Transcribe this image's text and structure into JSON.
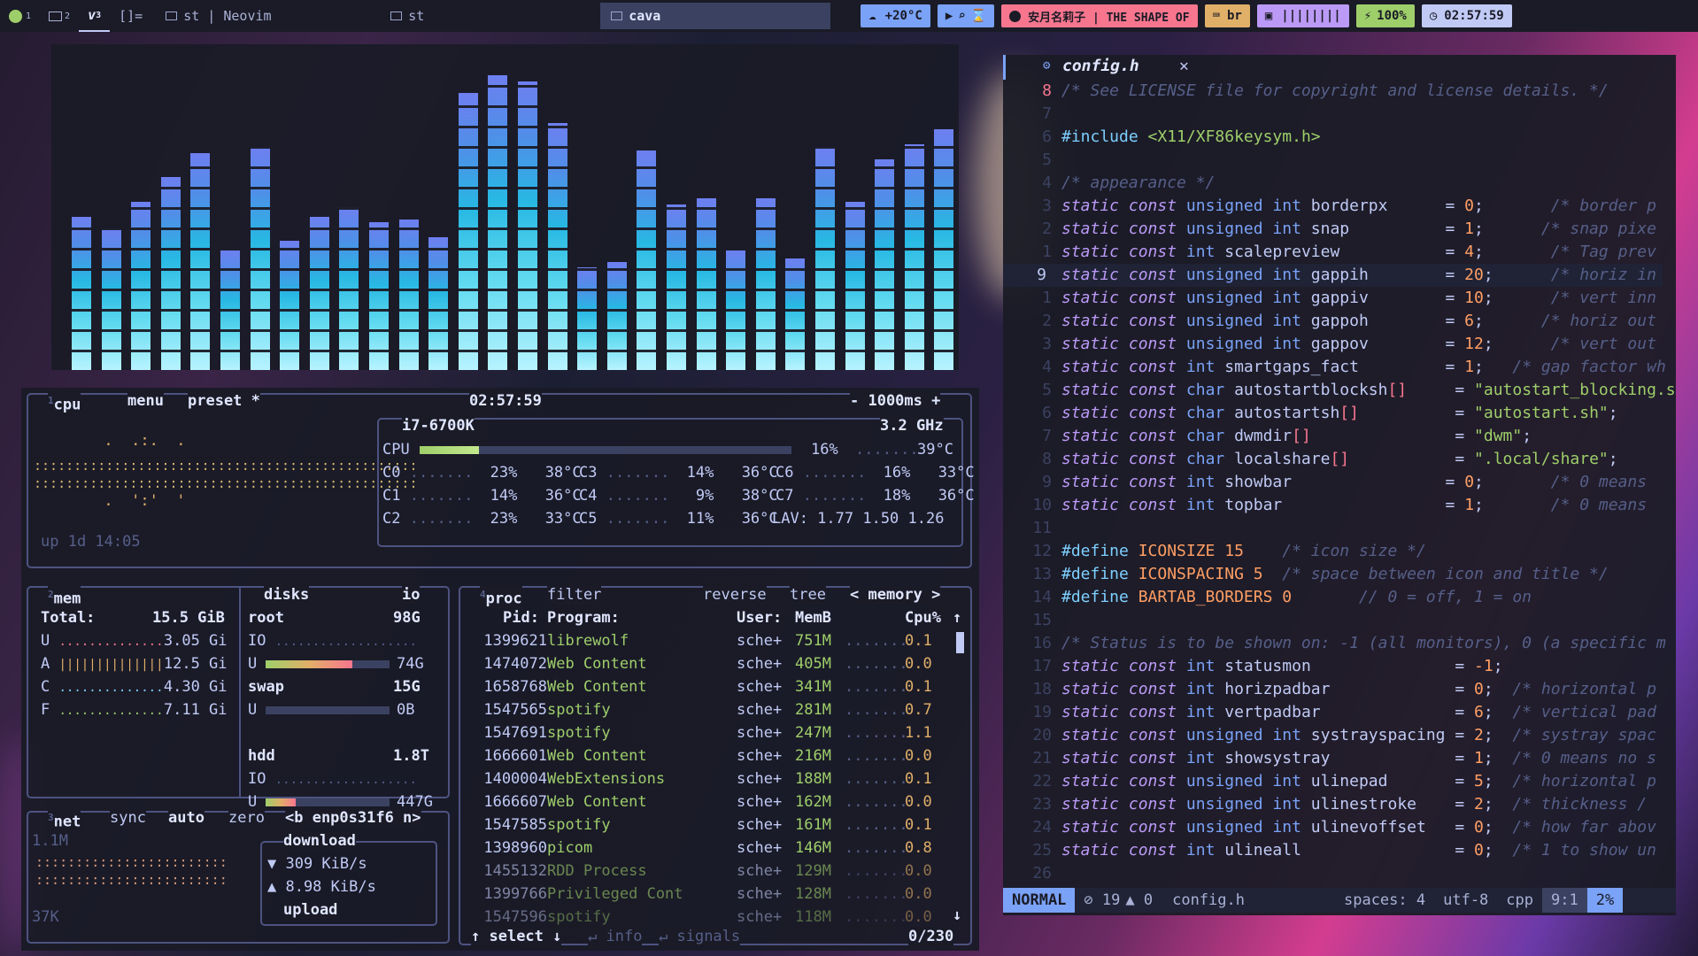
{
  "topbar": {
    "tags": [
      "1",
      "2",
      "3",
      "[]="
    ],
    "windows": [
      "st | Neovim",
      "st",
      "cava"
    ],
    "weather": "+20°C",
    "song": "安月名莉子 | THE SHAPE OF",
    "keyboard": "br",
    "cpu_bars": "||||||||",
    "battery": "100%",
    "clock": "02:57:59"
  },
  "cava": {
    "bars": [
      0.51,
      0.47,
      0.56,
      0.64,
      0.72,
      0.4,
      0.74,
      0.43,
      0.51,
      0.54,
      0.49,
      0.5,
      0.44,
      0.92,
      0.98,
      0.96,
      0.82,
      0.34,
      0.36,
      0.73,
      0.55,
      0.57,
      0.4,
      0.57,
      0.37,
      0.74,
      0.56,
      0.7,
      0.75,
      0.8
    ]
  },
  "btop": {
    "cpu": {
      "title": "cpu",
      "menu": "menu",
      "preset": "preset *",
      "clock": "02:57:59",
      "interval": "- 1000ms +",
      "model": "i7-6700K",
      "freq": "3.2 GHz",
      "total": {
        "label": "CPU",
        "pct": "16%",
        "temp": "39°C",
        "fill": 0.16
      },
      "cores": [
        {
          "name": "C0",
          "pct": "23%",
          "temp": "38°C"
        },
        {
          "name": "C1",
          "pct": "14%",
          "temp": "36°C"
        },
        {
          "name": "C2",
          "pct": "23%",
          "temp": "33°C"
        },
        {
          "name": "C3",
          "pct": "14%",
          "temp": "36°C"
        },
        {
          "name": "C4",
          "pct": "9%",
          "temp": "38°C"
        },
        {
          "name": "C5",
          "pct": "11%",
          "temp": "36°C"
        },
        {
          "name": "C6",
          "pct": "16%",
          "temp": "33°C"
        },
        {
          "name": "C7",
          "pct": "18%",
          "temp": "36°C"
        }
      ],
      "lav": "LAV: 1.77 1.50 1.26",
      "uptime": "up 1d 14:05"
    },
    "mem": {
      "title": "mem",
      "total_label": "Total:",
      "total": "15.5 GiB",
      "rows": [
        {
          "l": "U",
          "v": "3.05 Gi"
        },
        {
          "l": "A",
          "v": "12.5 Gi"
        },
        {
          "l": "C",
          "v": "4.30 Gi"
        },
        {
          "l": "F",
          "v": "7.11 Gi"
        }
      ]
    },
    "disks": {
      "title": "disks",
      "io": "io",
      "items": [
        {
          "name": "root",
          "size": "98G",
          "used": "74G",
          "fill": 0.7
        },
        {
          "name": "swap",
          "size": "15G",
          "used": "0B",
          "fill": 0.0
        },
        {
          "name": "hdd",
          "size": "1.8T",
          "used": "447G",
          "fill": 0.24
        }
      ],
      "io_label": "IO",
      "u_label": "U"
    },
    "net": {
      "title": "net",
      "sync": "sync",
      "auto": "auto",
      "zero": "zero",
      "iface": "<b enp0s31f6 n>",
      "top": "1.1M",
      "bottom": "37K",
      "download_label": "download",
      "down": "▼ 309 KiB/s",
      "up": "▲ 8.98 KiB/s",
      "upload_label": "upload"
    },
    "proc": {
      "title": "proc",
      "filter": "filter",
      "reverse": "reverse",
      "tree": "tree",
      "sort": "< memory >",
      "headers": [
        "Pid:",
        "Program:",
        "User:",
        "MemB",
        "Cpu%"
      ],
      "rows": [
        [
          "1399621",
          "librewolf",
          "sche+",
          "751M",
          "0.1"
        ],
        [
          "1474072",
          "Web Content",
          "sche+",
          "405M",
          "0.0"
        ],
        [
          "1658768",
          "Web Content",
          "sche+",
          "341M",
          "0.1"
        ],
        [
          "1547565",
          "spotify",
          "sche+",
          "281M",
          "0.7"
        ],
        [
          "1547691",
          "spotify",
          "sche+",
          "247M",
          "1.1"
        ],
        [
          "1666601",
          "Web Content",
          "sche+",
          "216M",
          "0.0"
        ],
        [
          "1400004",
          "WebExtensions",
          "sche+",
          "188M",
          "0.1"
        ],
        [
          "1666607",
          "Web Content",
          "sche+",
          "162M",
          "0.0"
        ],
        [
          "1547585",
          "spotify",
          "sche+",
          "161M",
          "0.1"
        ],
        [
          "1398960",
          "picom",
          "sche+",
          "146M",
          "0.8"
        ],
        [
          "1455132",
          "RDD Process",
          "sche+",
          "129M",
          "0.0"
        ],
        [
          "1399766",
          "Privileged Cont",
          "sche+",
          "128M",
          "0.0"
        ],
        [
          "1547596",
          "spotify",
          "sche+",
          "118M",
          "0.0"
        ]
      ],
      "select": "select",
      "info": "info",
      "signals": "signals",
      "count": "0/230"
    }
  },
  "nvim": {
    "tab": "config.h",
    "cursor_line_num": "9",
    "lines": [
      [
        "8",
        "c:/* See LICENSE file for copyright and license details. */"
      ],
      [
        "7",
        ""
      ],
      [
        "6",
        "p:#include |s:<X11/XF86keysym.h>"
      ],
      [
        "5",
        ""
      ],
      [
        "4",
        "c:/* appearance */"
      ],
      [
        "3",
        "k:static const |t:unsigned int |x:borderpx      = |n:0|x:;       |c:/* border p"
      ],
      [
        "2",
        "k:static const |t:unsigned int |x:snap          = |n:1|x:;      |c:/* snap pixe"
      ],
      [
        "1",
        "k:static const |t:int |x:scalepreview           = |n:4|x:;       |c:/* Tag prev"
      ],
      [
        "9",
        "k:static const |t:unsigned int |x:gappih        = |n:20|x:;      |c:/* horiz in"
      ],
      [
        "1",
        "k:static const |t:unsigned int |x:gappiv        = |n:10|x:;      |c:/* vert inn"
      ],
      [
        "2",
        "k:static const |t:unsigned int |x:gappoh        = |n:6|x:;      |c:/* horiz out"
      ],
      [
        "3",
        "k:static const |t:unsigned int |x:gappov        = |n:12|x:;      |c:/* vert out"
      ],
      [
        "4",
        "k:static const |t:int |x:smartgaps_fact         = |n:1|x:;   |c:/* gap factor wh"
      ],
      [
        "5",
        "k:static const |t:char |x:autostartblocksh|r:[]|x:     = |s:\"autostart_blocking.s"
      ],
      [
        "6",
        "k:static const |t:char |x:autostartsh|r:[]|x:          = |s:\"autostart.sh\"|x:;"
      ],
      [
        "7",
        "k:static const |t:char |x:dwmdir|r:[]|x:               = |s:\"dwm\"|x:;"
      ],
      [
        "8",
        "k:static const |t:char |x:localshare|r:[]|x:           = |s:\".local/share\"|x:;"
      ],
      [
        "9",
        "k:static const |t:int |x:showbar                = |n:0|x:;       |c:/* 0 means"
      ],
      [
        "10",
        "k:static const |t:int |x:topbar                 = |n:1|x:;       |c:/* 0 means"
      ],
      [
        "11",
        ""
      ],
      [
        "12",
        "p:#define |n:ICONSIZE 15    |c:/* icon size */"
      ],
      [
        "13",
        "p:#define |n:ICONSPACING 5  |c:/* space between icon and title */"
      ],
      [
        "14",
        "p:#define |n:BARTAB_BORDERS 0       |c:// 0 = off, 1 = on"
      ],
      [
        "15",
        ""
      ],
      [
        "16",
        "c:/* Status is to be shown on: -1 (all monitors), 0 (a specific m"
      ],
      [
        "17",
        "k:static const |t:int |x:statusmon               = |n:-1|x:;"
      ],
      [
        "18",
        "k:static const |t:int |x:horizpadbar             = |n:0|x:;  |c:/* horizontal p"
      ],
      [
        "19",
        "k:static const |t:int |x:vertpadbar              = |n:6|x:;  |c:/* vertical pad"
      ],
      [
        "20",
        "k:static const |t:unsigned int |x:systrayspacing = |n:2|x:;  |c:/* systray spac"
      ],
      [
        "21",
        "k:static const |t:int |x:showsystray             = |n:1|x:;  |c:/* 0 means no s"
      ],
      [
        "22",
        "k:static const |t:unsigned int |x:ulinepad       = |n:5|x:;  |c:/* horizontal p"
      ],
      [
        "23",
        "k:static const |t:unsigned int |x:ulinestroke    = |n:2|x:;  |c:/* thickness / "
      ],
      [
        "24",
        "k:static const |t:unsigned int |x:ulinevoffset   = |n:0|x:;  |c:/* how far abov"
      ],
      [
        "25",
        "k:static const |t:int |x:ulineall                = |n:0|x:;  |c:/* 1 to show un"
      ],
      [
        "26",
        ""
      ]
    ],
    "status": {
      "mode": "NORMAL",
      "errors": "⊘ 19",
      "warnings": "▲ 0",
      "file": "config.h",
      "spaces": "spaces: 4",
      "enc": "utf-8",
      "ft": "cpp",
      "pos": "9:1",
      "pct": "2%"
    }
  },
  "colors": {
    "bg": "#1a1b26",
    "accent": "#7aa2f7",
    "cava_top": "#6e7ff0",
    "cava_bottom": "#b7f3ff",
    "mode_bg": "#7aa2f7"
  }
}
